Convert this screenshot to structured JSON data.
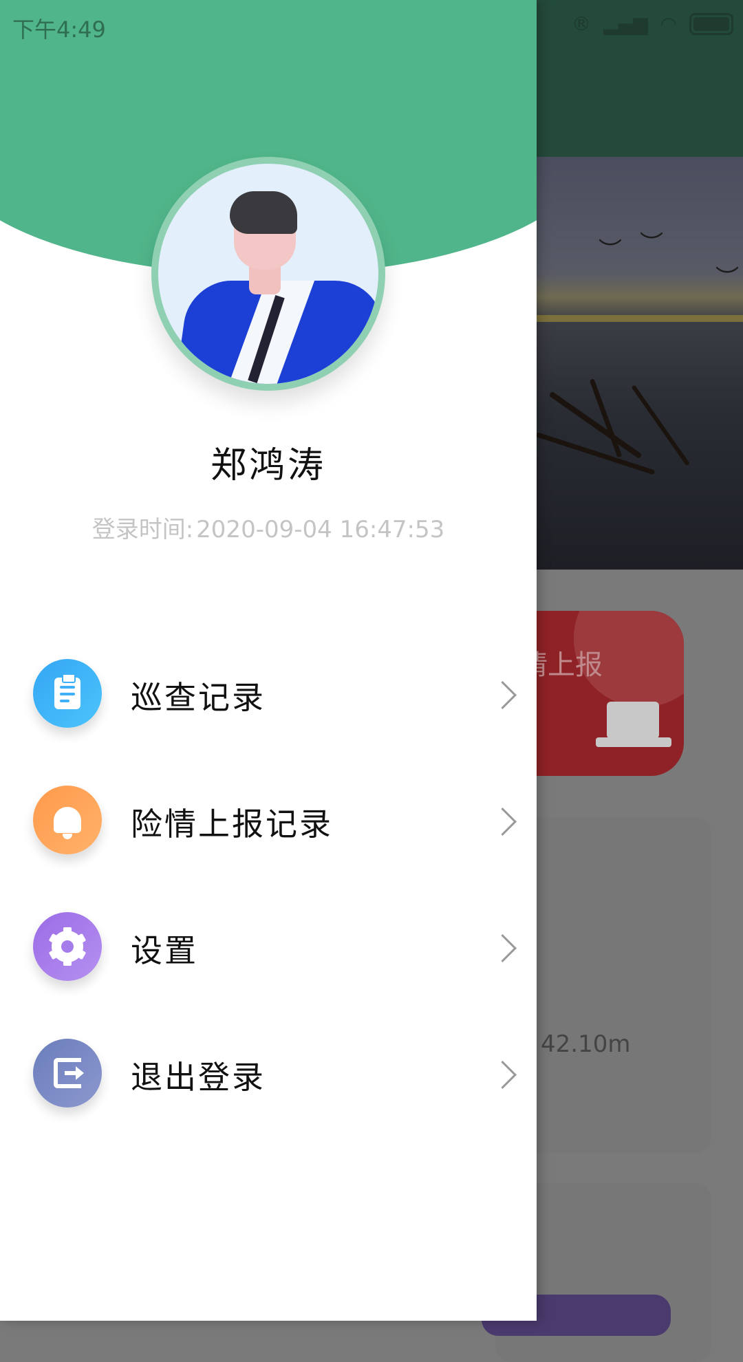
{
  "status_bar": {
    "time": "下午4:49"
  },
  "drawer": {
    "user_name": "郑鸿涛",
    "login_time_label": "登录时间:",
    "login_time_value": "2020-09-04 16:47:53",
    "menu": [
      {
        "label": "巡查记录",
        "icon": "clipboard-icon",
        "color": "#35a6f5"
      },
      {
        "label": "险情上报记录",
        "icon": "bell-icon",
        "color": "#ff9a4c"
      },
      {
        "label": "设置",
        "icon": "gear-icon",
        "color": "#9b6be6"
      },
      {
        "label": "退出登录",
        "icon": "logout-icon",
        "color": "#6a7dbb"
      }
    ],
    "accent_color": "#50b58a"
  },
  "background_app": {
    "report_card_label": "情上报",
    "water_level_value": "42.10m"
  }
}
